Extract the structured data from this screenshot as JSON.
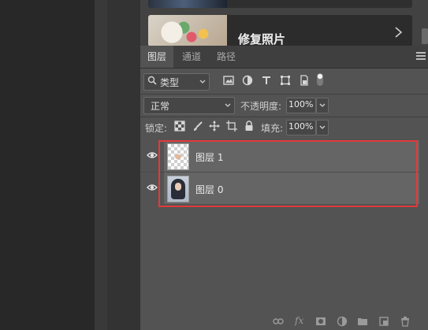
{
  "learn": {
    "card_title": "修复照片"
  },
  "tabs": [
    {
      "label": "图层",
      "active": true
    },
    {
      "label": "通道",
      "active": false
    },
    {
      "label": "路径",
      "active": false
    }
  ],
  "filter": {
    "kind_label": "类型",
    "icons": [
      "pixel-filter-icon",
      "adjustment-filter-icon",
      "type-filter-icon",
      "shape-filter-icon",
      "smart-object-filter-icon",
      "filter-toggle-icon"
    ]
  },
  "blend": {
    "mode": "正常",
    "opacity_label": "不透明度:",
    "opacity_value": "100%"
  },
  "lock": {
    "label": "锁定:",
    "fill_label": "填充:",
    "fill_value": "100%",
    "icons": [
      "lock-transparent-icon",
      "lock-image-icon",
      "lock-position-icon",
      "lock-artboard-icon",
      "lock-all-icon"
    ]
  },
  "layers": [
    {
      "name": "图层 1",
      "visible": true,
      "thumb": "transparent"
    },
    {
      "name": "图层 0",
      "visible": true,
      "thumb": "photo"
    }
  ],
  "bottom_icons": [
    "link-layers-icon",
    "fx-icon",
    "add-mask-icon",
    "adjustment-layer-icon",
    "new-group-icon",
    "new-layer-icon",
    "delete-layer-icon"
  ],
  "colors": {
    "panel_bg": "#535353",
    "selected_layer_bg": "#656565",
    "highlight_box": "#e23a3a"
  }
}
